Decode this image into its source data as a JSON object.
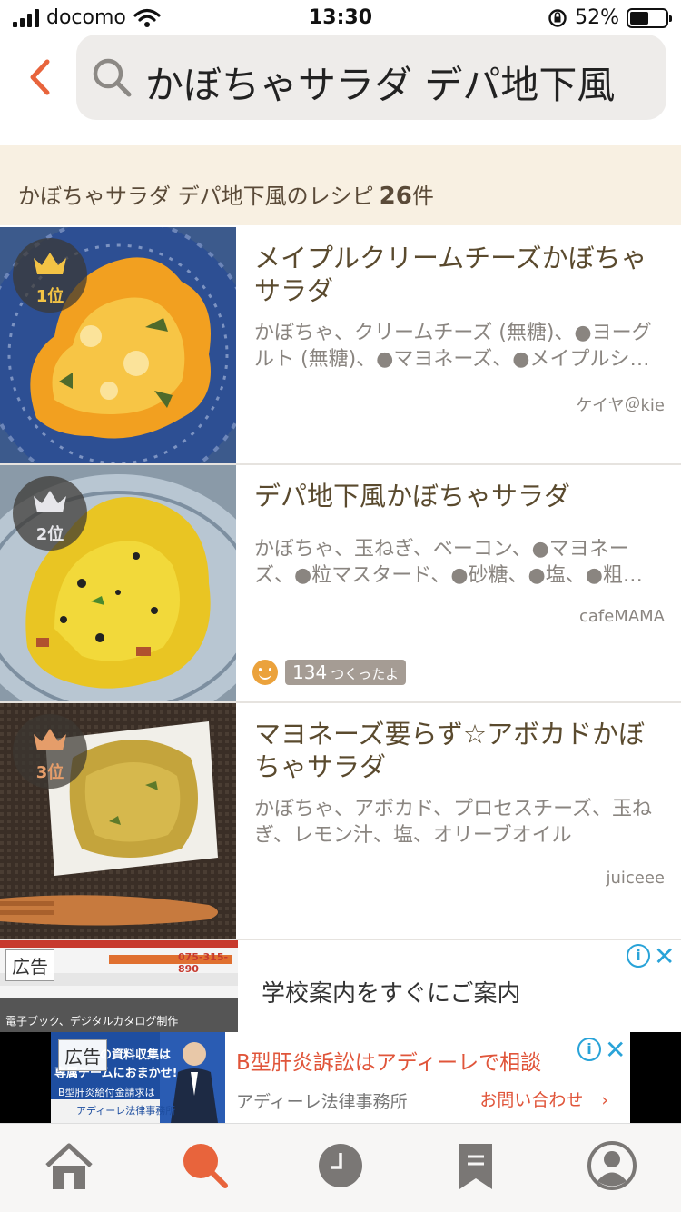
{
  "status_bar": {
    "carrier": "docomo",
    "time": "13:30",
    "battery": "52%",
    "battery_level": 0.52
  },
  "search": {
    "query": "かぼちゃサラダ デパ地下風"
  },
  "results": {
    "label": "かぼちゃサラダ デパ地下風のレシピ",
    "count": "26",
    "unit": "件"
  },
  "recipes": [
    {
      "rank": "1位",
      "title": "メイプルクリームチーズかぼちゃサラダ",
      "ingredients": "かぼちゃ、クリームチーズ (無糖)、●ヨーグルト (無糖)、●マヨネーズ、●メイプルシ…",
      "author": "ケイヤ＠kie"
    },
    {
      "rank": "2位",
      "title": "デパ地下風かぼちゃサラダ",
      "ingredients": "かぼちゃ、玉ねぎ、ベーコン、●マヨネーズ、●粒マスタード、●砂糖、●塩、●粗…",
      "author": "cafeMAMA",
      "tsukurepo_count": "134",
      "tsukurepo_label": "つくったよ"
    },
    {
      "rank": "3位",
      "title": "マヨネーズ要らず☆アボカドかぼちゃサラダ",
      "ingredients": "かぼちゃ、アボカド、プロセスチーズ、玉ねぎ、レモン汁、塩、オリーブオイル",
      "author": "juiceee"
    }
  ],
  "ads": [
    {
      "label": "広告",
      "text": "学校案内をすぐにご案内",
      "image_text": [
        "075-315-890",
        "電子ブック、デジタルカタログ制作"
      ]
    },
    {
      "label": "広告",
      "headline": "B型肝炎訴訟はアディーレで相談",
      "advertiser": "アディーレ法律事務所",
      "cta": "お問い合わせ",
      "image_text": [
        "の資料収集は",
        "専属チームにおまかせ!",
        "B型肝炎給付金請求は",
        "アディーレ法律事務所"
      ]
    }
  ],
  "colors": {
    "accent": "#e8643c",
    "tab_icon": "#7a7775",
    "banner_bg": "#f8f0e2"
  },
  "tabs": [
    {
      "name": "home",
      "icon": "home-icon"
    },
    {
      "name": "search",
      "icon": "search-icon",
      "active": true
    },
    {
      "name": "history",
      "icon": "clock-icon"
    },
    {
      "name": "bookmark",
      "icon": "bookmark-icon"
    },
    {
      "name": "mypage",
      "icon": "user-icon"
    }
  ]
}
